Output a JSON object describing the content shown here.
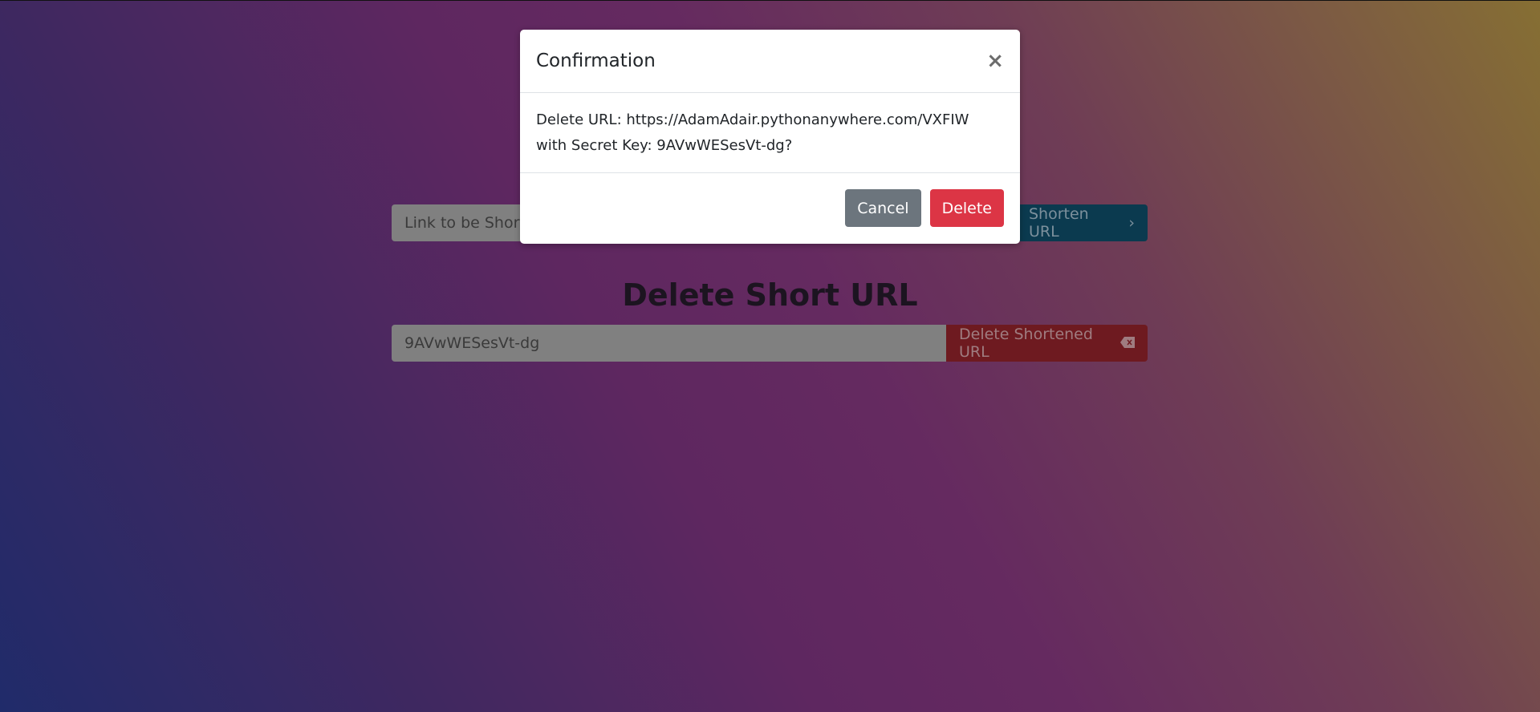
{
  "shorten_form": {
    "placeholder": "Link to be Shortened",
    "button_label": "Shorten URL"
  },
  "delete_section": {
    "heading": "Delete Short URL",
    "input_value": "9AVwWESesVt-dg",
    "button_label": "Delete Shortened URL"
  },
  "modal": {
    "title": "Confirmation",
    "close_label": "×",
    "message": "Delete URL: https://AdamAdair.pythonanywhere.com/VXFIW with Secret Key: 9AVwWESesVt-dg?",
    "cancel_label": "Cancel",
    "delete_label": "Delete"
  },
  "colors": {
    "cancel": "#6c757d",
    "delete": "#dc3545",
    "shorten": "#17a2b8"
  }
}
